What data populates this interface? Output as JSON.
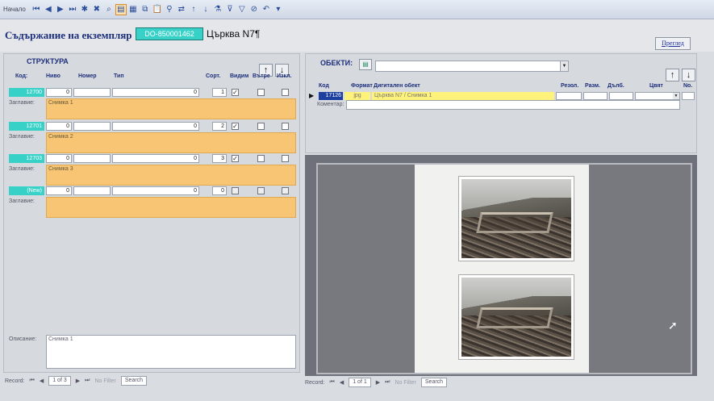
{
  "toolbar": {
    "record_label": "Начало",
    "icons": [
      "first-record",
      "prev-record",
      "next-record",
      "last-record",
      "new-record",
      "delete-record",
      "find",
      "preview",
      "print",
      "copy",
      "paste",
      "find",
      "replace",
      "sort-asc",
      "sort-desc",
      "filter",
      "toggle-filter",
      "apply-filter",
      "undo",
      "more"
    ]
  },
  "header": {
    "title": "Съдържание на екземпляр",
    "inventory_number": "DO-850001462",
    "object_name": "Църква N7¶",
    "preview_button": "Преглед"
  },
  "structure": {
    "section_title": "СТРУКТУРА",
    "columns": {
      "code": "Код:",
      "level": "Ниво",
      "number": "Номер",
      "type": "Тип",
      "sort": "Сорт.",
      "visible": "Видим",
      "internal": "Вътре",
      "exclude": "Изкл."
    },
    "title_label": "Заглавие:",
    "rows": [
      {
        "code": "12700",
        "level": "0",
        "type": "0",
        "sort": "1",
        "visible": "✓",
        "title": "Снимка 1"
      },
      {
        "code": "12701",
        "level": "0",
        "type": "0",
        "sort": "2",
        "visible": "✓",
        "title": "Снимка 2"
      },
      {
        "code": "12703",
        "level": "0",
        "type": "0",
        "sort": "3",
        "visible": "✓",
        "title": "Снимка 3"
      },
      {
        "code": "(New)",
        "level": "0",
        "type": "0",
        "sort": "0",
        "visible": "",
        "title": ""
      }
    ],
    "description_label": "Описание:",
    "description_value": "Снимка 1",
    "nav": {
      "record": "Record:",
      "position": "1 of 3",
      "no_filter": "No Filter",
      "search": "Search"
    }
  },
  "objects": {
    "section_title": "ОБЕКТИ:",
    "columns": {
      "code": "Код",
      "format": "Формат",
      "digital_object": "Дигитален обект",
      "resolution": "Резол.",
      "size": "Разм.",
      "depth": "Дълб.",
      "color": "Цвят",
      "no": "No."
    },
    "row": {
      "code": "17126",
      "format": "jpg",
      "name": "Църква N7 / Снимка 1"
    },
    "comment_label": "Коментар:",
    "nav": {
      "record": "Record:",
      "position": "1 of 1",
      "no_filter": "No Filter",
      "search": "Search"
    }
  }
}
